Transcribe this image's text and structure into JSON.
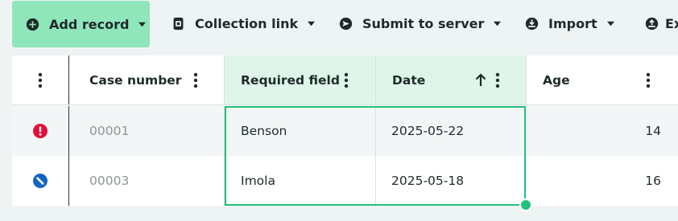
{
  "toolbar": {
    "add_record": "Add record",
    "collection_link": "Collection link",
    "submit_to_server": "Submit to server",
    "import": "Import",
    "export_partial": "Ex"
  },
  "colors": {
    "primary_button": "#8fe6bb",
    "selection": "#22c07a",
    "active_header": "#dff5ea",
    "error": "#e0103a",
    "blocked": "#1565c0"
  },
  "columns": {
    "case_number": "Case number",
    "required_field": "Required field",
    "date": "Date",
    "age": "Age"
  },
  "sort": {
    "column": "Date",
    "direction": "ascending"
  },
  "rows": [
    {
      "status": "error-icon",
      "case_number": "00001",
      "required_field": "Benson",
      "date": "2025-05-22",
      "age": "14"
    },
    {
      "status": "blocked-icon",
      "case_number": "00003",
      "required_field": "Imola",
      "date": "2025-05-18",
      "age": "16"
    }
  ]
}
